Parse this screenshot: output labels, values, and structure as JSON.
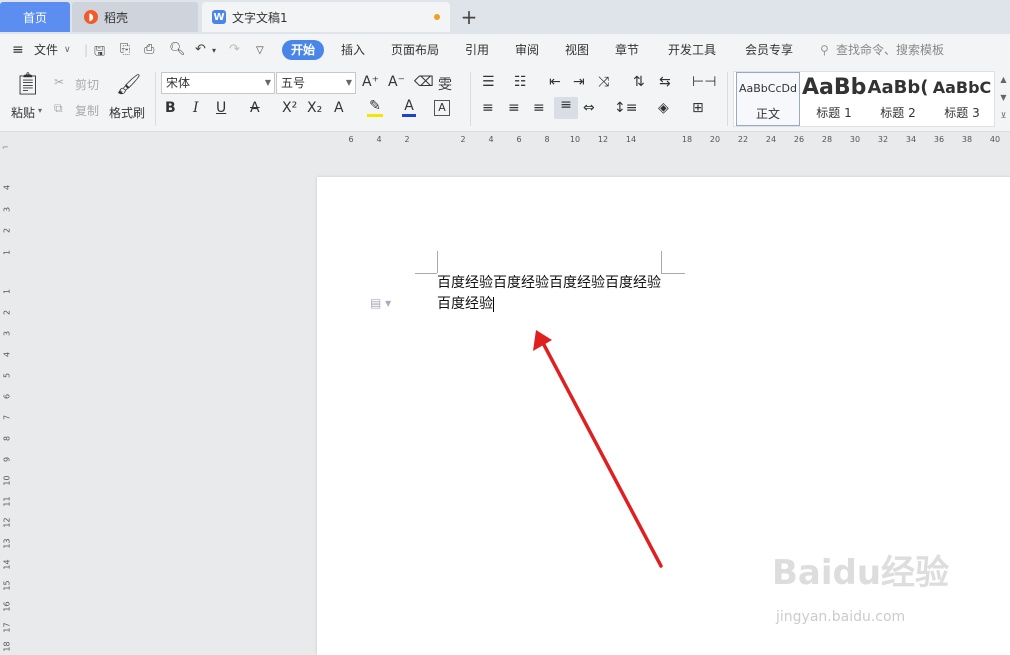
{
  "tabs": {
    "home": "首页",
    "daoke": "稻壳",
    "doc": "文字文稿1",
    "doc_icon": "W",
    "new_tab": "+"
  },
  "menu": {
    "file": "文件",
    "items": [
      "开始",
      "插入",
      "页面布局",
      "引用",
      "审阅",
      "视图",
      "章节",
      "开发工具",
      "会员专享"
    ],
    "search_placeholder": "查找命令、搜索模板"
  },
  "ribbon": {
    "paste": "粘贴",
    "cut": "剪切",
    "copy": "复制",
    "format_painter": "格式刷",
    "font_name": "宋体",
    "font_size": "五号"
  },
  "styles": [
    {
      "preview": "AaBbCcDd",
      "name": "正文"
    },
    {
      "preview": "AaBb",
      "name": "标题 1"
    },
    {
      "preview": "AaBb(",
      "name": "标题 2"
    },
    {
      "preview": "AaBbC",
      "name": "标题 3"
    }
  ],
  "ruler": {
    "horizontal": [
      "6",
      "4",
      "2",
      "2",
      "4",
      "6",
      "8",
      "10",
      "12",
      "14",
      "18",
      "20",
      "22",
      "24",
      "26",
      "28",
      "30",
      "32",
      "34",
      "36",
      "38",
      "40"
    ],
    "vertical": [
      "4",
      "3",
      "2",
      "1",
      "1",
      "2",
      "3",
      "4",
      "5",
      "6",
      "7",
      "8",
      "9",
      "10",
      "11",
      "12",
      "13",
      "14",
      "15",
      "16",
      "17",
      "18"
    ]
  },
  "document": {
    "line1": "百度经验百度经验百度经验百度经验",
    "line2": "百度经验"
  },
  "watermark": {
    "brand": "Baidu经验",
    "url": "jingyan.baidu.com"
  },
  "colors": {
    "accent": "#4a86e8",
    "arrow": "#e02020",
    "highlight": "#f5e600",
    "font_color": "#2040d0"
  }
}
